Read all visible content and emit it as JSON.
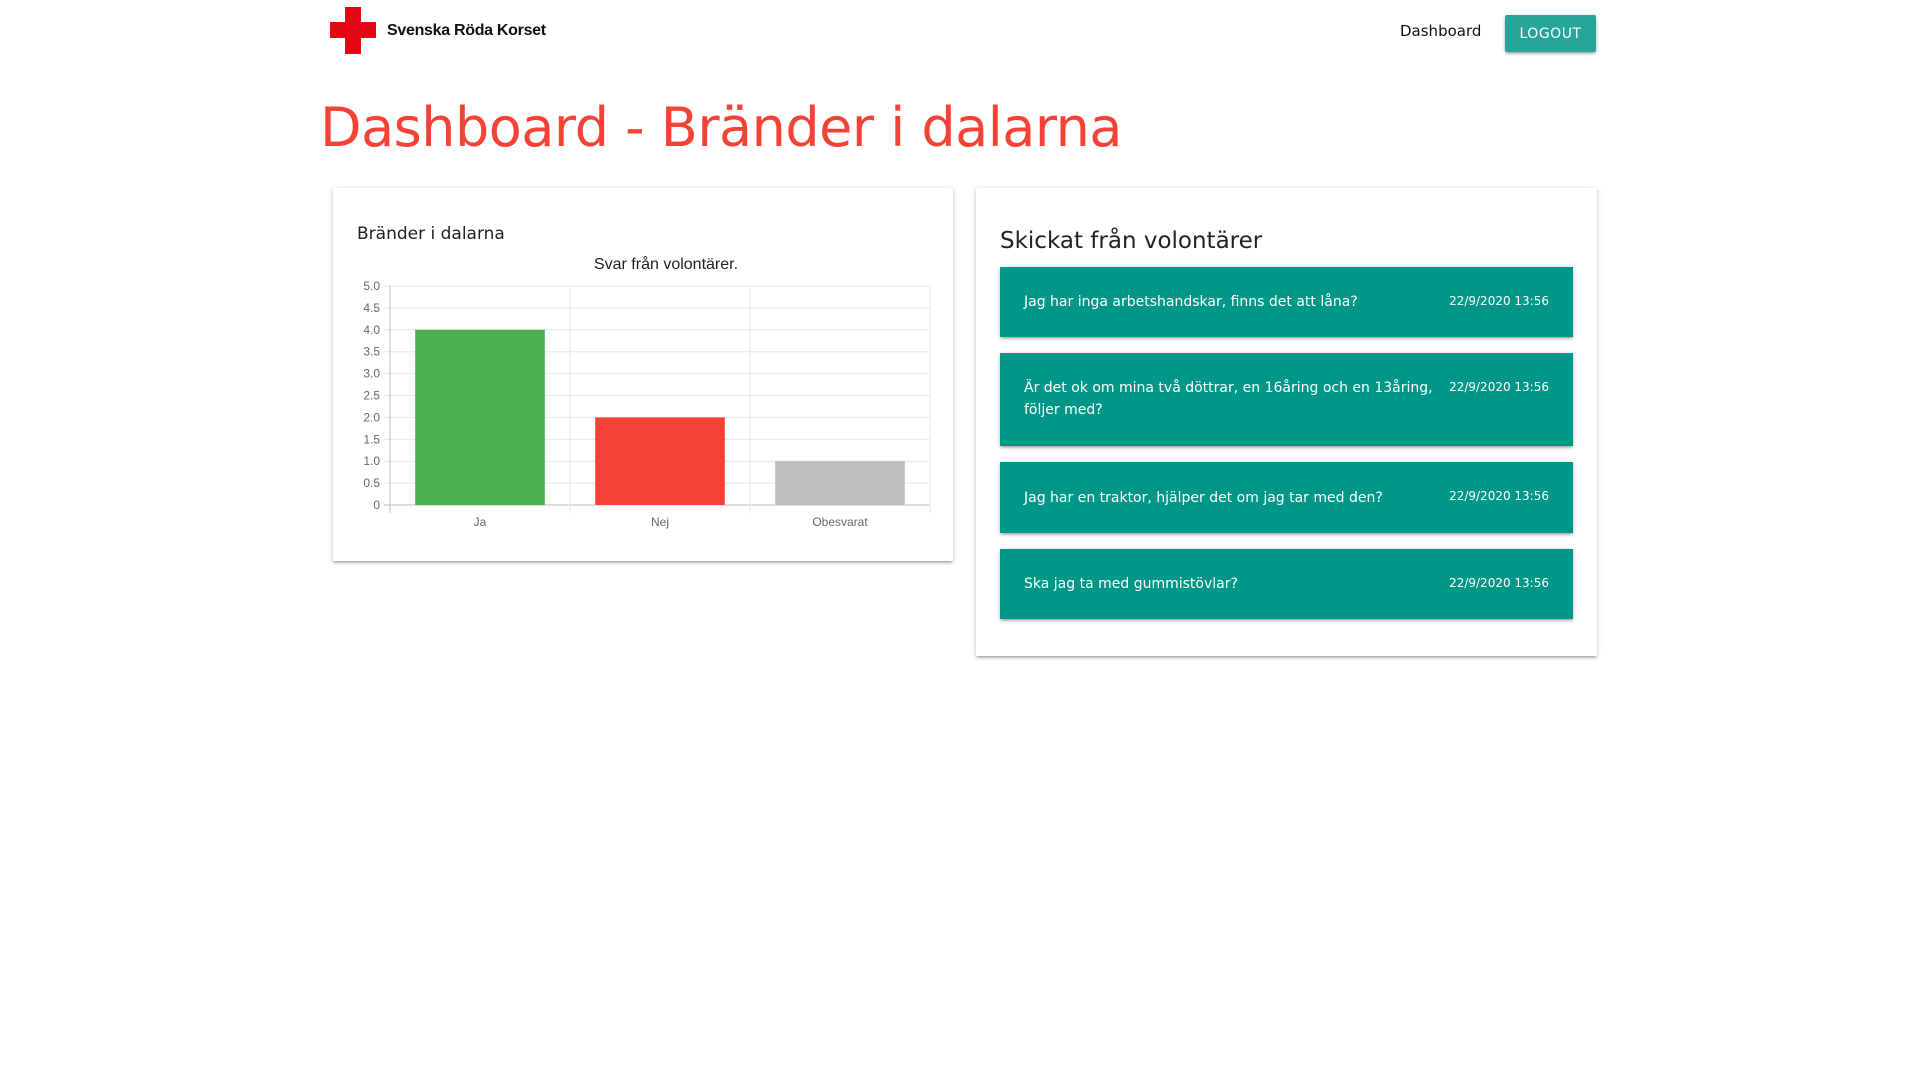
{
  "brand": {
    "name": "Svenska Röda Korset",
    "color": "#e30613"
  },
  "nav": {
    "dashboard_label": "Dashboard",
    "logout_label": "LOGOUT"
  },
  "page": {
    "title": "Dashboard - Bränder i dalarna"
  },
  "chart_card": {
    "title": "Bränder i dalarna"
  },
  "chart_data": {
    "type": "bar",
    "title": "Svar från volontärer.",
    "categories": [
      "Ja",
      "Nej",
      "Obesvarat"
    ],
    "values": [
      4,
      2,
      1
    ],
    "colors": [
      "#4caf50",
      "#f44336",
      "#bdbdbd"
    ],
    "ylim": [
      0,
      5
    ],
    "yticks": [
      "0",
      "0.5",
      "1.0",
      "1.5",
      "2.0",
      "2.5",
      "3.0",
      "3.5",
      "4.0",
      "4.5",
      "5.0"
    ],
    "grid": true
  },
  "messages_card": {
    "title": "Skickat från volontärer",
    "items": [
      {
        "text": "Jag har inga arbetshandskar, finns det att låna?",
        "time": "22/9/2020 13:56"
      },
      {
        "text": "Är det ok om mina två döttrar, en 16åring och en 13åring, följer med?",
        "time": "22/9/2020 13:56"
      },
      {
        "text": "Jag har en traktor, hjälper det om jag tar med den?",
        "time": "22/9/2020 13:56"
      },
      {
        "text": "Ska jag ta med gummistövlar?",
        "time": "22/9/2020 13:56"
      }
    ]
  },
  "colors": {
    "accent": "#26a69a",
    "message_bg": "#009688",
    "title": "#f44336"
  }
}
